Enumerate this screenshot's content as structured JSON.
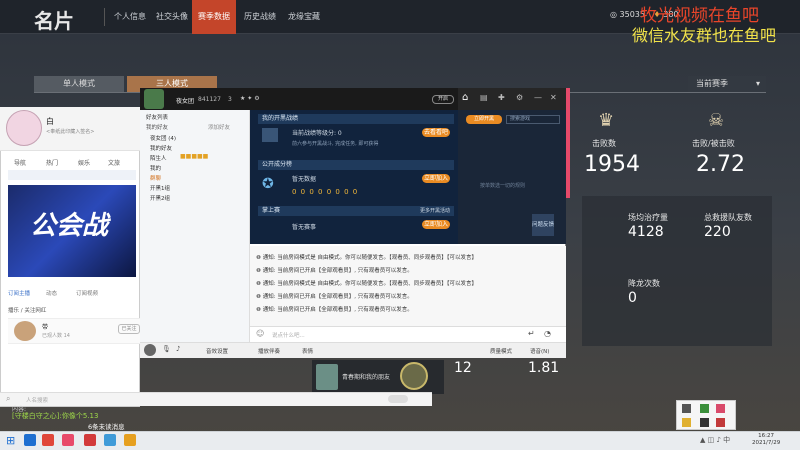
{
  "window": {
    "title": "名片"
  },
  "nav": {
    "items": [
      {
        "label": "个人信息"
      },
      {
        "label": "社交头像"
      },
      {
        "label": "赛季数据"
      },
      {
        "label": "历史战绩"
      },
      {
        "label": "龙缘宝藏"
      }
    ],
    "active": "赛季数据"
  },
  "currency": {
    "value1": "35035",
    "value2": "380"
  },
  "watermark": {
    "line1": "牧光视频在鱼吧",
    "line2": "微信水友群也在鱼吧"
  },
  "mode_tabs": {
    "single": "单人模式",
    "triple": "三人模式"
  },
  "season_select": {
    "value": "当前赛季"
  },
  "stats": {
    "kills_label": "击败数",
    "kills_value": "1954",
    "kd_label": "击败/被击败",
    "kd_value": "2.72",
    "heal_label": "场均治疗量",
    "heal_value": "4128",
    "revive_label": "总救援队友数",
    "revive_value": "220",
    "fall_label": "降龙次数",
    "fall_value": "0",
    "bottom_left": "12",
    "bottom_right": "1.81"
  },
  "profile_window": {
    "name": "白",
    "subtitle": "<奉纸此印藏入签名>",
    "tabs": [
      "导航",
      "热门",
      "娱乐",
      "文旅"
    ],
    "banner_text": "公会战",
    "section_tabs": [
      "订阅主播",
      "动态",
      "订阅视频"
    ],
    "hint": "播乐 / 关注网红",
    "follow_name": "带",
    "follow_sub": "已观人数 14",
    "follow_btn": "已关注",
    "search_placeholder": "人名搜索"
  },
  "qq": {
    "username": "夜女团",
    "level": "841127",
    "count": "3",
    "top_btn": "开启",
    "side_header": "好友列表",
    "side_tabs": [
      "我的好友",
      "添加好友"
    ],
    "side_groups": [
      {
        "label": "夜女团 (4)"
      },
      {
        "label": "我的好友"
      },
      {
        "label": "陌生人"
      },
      {
        "label": "我的"
      },
      {
        "label": "群聊"
      },
      {
        "label": "开黑1组"
      },
      {
        "label": "开黑2组"
      }
    ],
    "panel": {
      "sec1_title": "我的开黑战绩",
      "sec1_line": "当前战绩等级分: 0",
      "sec1_btn": "去看看吧",
      "sec1_sub": "前六参与开黑战斗, 完成任务, 即可获得",
      "sec2_title": "公开成分榜",
      "sec2_line": "暂无数据",
      "sec2_btn": "立即加入",
      "sec2_digits": "0 0 0 0 0 0 0 0",
      "sec3_title": "掌上赛",
      "sec3_right": "更多开黑活动",
      "sec3_line": "暂无赛事",
      "sec3_btn": "立即加入"
    },
    "right": {
      "tab1": "立即开黑",
      "tab2": "搜索游戏",
      "mid": "按单数选一切的规则",
      "chip": "问题反馈"
    },
    "messages": [
      "通知: 当前房间模式是 自由模式。你可以随便发言。【观看员、同步观看员】【可以发言】",
      "通知: 当前房间已开启【全部观看员】, 只有观看员可以发言。",
      "通知: 当前房间模式是 自由模式。你可以随便发言。【观看员、同步观看员】【可以发言】",
      "通知: 当前房间已开启【全部观看员】, 只有观看员可以发言。",
      "通知: 当前房间已开启【全部观看员】, 只有观看员可以发言。"
    ],
    "input_placeholder": "说点什么吧...",
    "bottom": [
      "音效设置",
      "播放伴奏",
      "表情"
    ],
    "bottom_right": [
      "质量模式",
      "语音(N)"
    ]
  },
  "chat": {
    "line": "[守楼白守之心]:你像个5.13",
    "unread": "6条未读消息",
    "hint": "内容:"
  },
  "player_card": {
    "name": "青春期和我的朋友"
  },
  "clock": {
    "time": "16:27",
    "date": "2021/7/29"
  }
}
